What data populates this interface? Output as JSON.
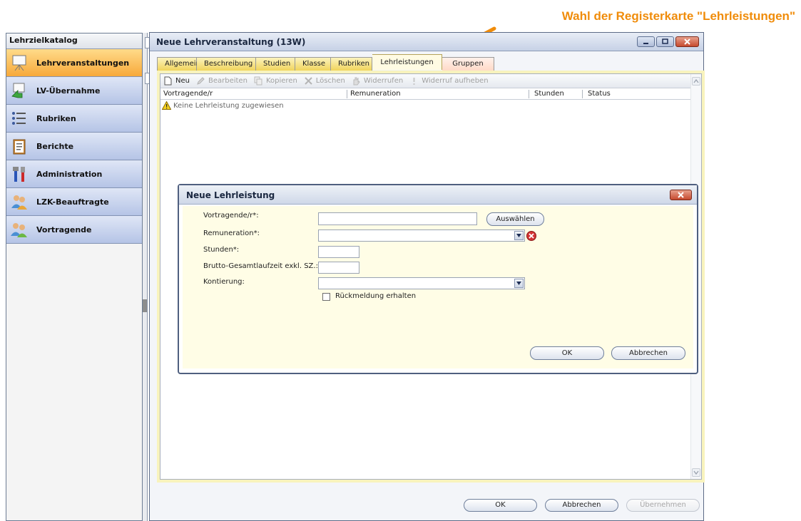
{
  "annotation": {
    "text": "Wahl der Registerkarte \"Lehrleistungen\"",
    "color": "#f08c0a"
  },
  "nav": {
    "header": "Lehrzielkatalog",
    "items": [
      {
        "label": "Lehrveranstaltungen",
        "icon": "presentation-board-icon",
        "active": true
      },
      {
        "label": "LV-Übernahme",
        "icon": "import-arrow-icon"
      },
      {
        "label": "Rubriken",
        "icon": "list-bullets-icon"
      },
      {
        "label": "Berichte",
        "icon": "clipboard-report-icon"
      },
      {
        "label": "Administration",
        "icon": "tools-icon"
      },
      {
        "label": "LZK-Beauftragte",
        "icon": "users-icon"
      },
      {
        "label": "Vortragende",
        "icon": "lecturers-icon"
      }
    ]
  },
  "window": {
    "title": "Neue Lehrveranstaltung (13W)",
    "tabs": [
      "Allgemein",
      "Beschreibung",
      "Studien",
      "Klasse",
      "Rubriken",
      "Lehrleistungen",
      "Gruppen"
    ],
    "active_tab": "Lehrleistungen",
    "toolbar": {
      "new": "Neu",
      "edit": "Bearbeiten",
      "copy": "Kopieren",
      "delete": "Löschen",
      "revoke": "Widerrufen",
      "cancel_revoke": "Widerruf aufheben"
    },
    "columns": {
      "lecturer": "Vortragende/r",
      "remuneration": "Remuneration",
      "hours": "Stunden",
      "status": "Status"
    },
    "empty_message": "Keine Lehrleistung zugewiesen",
    "buttons": {
      "ok": "OK",
      "cancel": "Abbrechen",
      "apply": "Übernehmen"
    }
  },
  "dialog": {
    "title": "Neue Lehrleistung",
    "fields": {
      "lecturer_label": "Vortragende/r*:",
      "lecturer_value": "",
      "select_button": "Auswählen",
      "remuneration_label": "Remuneration*:",
      "remuneration_value": "",
      "hours_label": "Stunden*:",
      "hours_value": "",
      "gross_runtime_label": "Brutto-Gesamtlaufzeit exkl. SZ.:",
      "gross_runtime_value": "",
      "account_label": "Kontierung:",
      "account_value": "",
      "feedback_label": "Rückmeldung erhalten",
      "feedback_checked": false
    },
    "buttons": {
      "ok": "OK",
      "cancel": "Abbrechen"
    }
  }
}
